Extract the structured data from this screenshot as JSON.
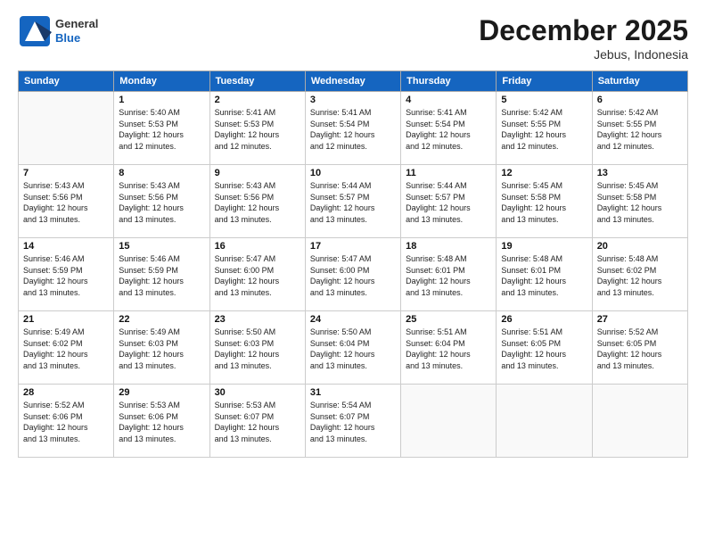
{
  "header": {
    "logo_general": "General",
    "logo_blue": "Blue",
    "title": "December 2025",
    "subtitle": "Jebus, Indonesia"
  },
  "weekdays": [
    "Sunday",
    "Monday",
    "Tuesday",
    "Wednesday",
    "Thursday",
    "Friday",
    "Saturday"
  ],
  "weeks": [
    [
      {
        "day": "",
        "info": ""
      },
      {
        "day": "1",
        "info": "Sunrise: 5:40 AM\nSunset: 5:53 PM\nDaylight: 12 hours\nand 12 minutes."
      },
      {
        "day": "2",
        "info": "Sunrise: 5:41 AM\nSunset: 5:53 PM\nDaylight: 12 hours\nand 12 minutes."
      },
      {
        "day": "3",
        "info": "Sunrise: 5:41 AM\nSunset: 5:54 PM\nDaylight: 12 hours\nand 12 minutes."
      },
      {
        "day": "4",
        "info": "Sunrise: 5:41 AM\nSunset: 5:54 PM\nDaylight: 12 hours\nand 12 minutes."
      },
      {
        "day": "5",
        "info": "Sunrise: 5:42 AM\nSunset: 5:55 PM\nDaylight: 12 hours\nand 12 minutes."
      },
      {
        "day": "6",
        "info": "Sunrise: 5:42 AM\nSunset: 5:55 PM\nDaylight: 12 hours\nand 12 minutes."
      }
    ],
    [
      {
        "day": "7",
        "info": "Sunrise: 5:43 AM\nSunset: 5:56 PM\nDaylight: 12 hours\nand 13 minutes."
      },
      {
        "day": "8",
        "info": "Sunrise: 5:43 AM\nSunset: 5:56 PM\nDaylight: 12 hours\nand 13 minutes."
      },
      {
        "day": "9",
        "info": "Sunrise: 5:43 AM\nSunset: 5:56 PM\nDaylight: 12 hours\nand 13 minutes."
      },
      {
        "day": "10",
        "info": "Sunrise: 5:44 AM\nSunset: 5:57 PM\nDaylight: 12 hours\nand 13 minutes."
      },
      {
        "day": "11",
        "info": "Sunrise: 5:44 AM\nSunset: 5:57 PM\nDaylight: 12 hours\nand 13 minutes."
      },
      {
        "day": "12",
        "info": "Sunrise: 5:45 AM\nSunset: 5:58 PM\nDaylight: 12 hours\nand 13 minutes."
      },
      {
        "day": "13",
        "info": "Sunrise: 5:45 AM\nSunset: 5:58 PM\nDaylight: 12 hours\nand 13 minutes."
      }
    ],
    [
      {
        "day": "14",
        "info": "Sunrise: 5:46 AM\nSunset: 5:59 PM\nDaylight: 12 hours\nand 13 minutes."
      },
      {
        "day": "15",
        "info": "Sunrise: 5:46 AM\nSunset: 5:59 PM\nDaylight: 12 hours\nand 13 minutes."
      },
      {
        "day": "16",
        "info": "Sunrise: 5:47 AM\nSunset: 6:00 PM\nDaylight: 12 hours\nand 13 minutes."
      },
      {
        "day": "17",
        "info": "Sunrise: 5:47 AM\nSunset: 6:00 PM\nDaylight: 12 hours\nand 13 minutes."
      },
      {
        "day": "18",
        "info": "Sunrise: 5:48 AM\nSunset: 6:01 PM\nDaylight: 12 hours\nand 13 minutes."
      },
      {
        "day": "19",
        "info": "Sunrise: 5:48 AM\nSunset: 6:01 PM\nDaylight: 12 hours\nand 13 minutes."
      },
      {
        "day": "20",
        "info": "Sunrise: 5:48 AM\nSunset: 6:02 PM\nDaylight: 12 hours\nand 13 minutes."
      }
    ],
    [
      {
        "day": "21",
        "info": "Sunrise: 5:49 AM\nSunset: 6:02 PM\nDaylight: 12 hours\nand 13 minutes."
      },
      {
        "day": "22",
        "info": "Sunrise: 5:49 AM\nSunset: 6:03 PM\nDaylight: 12 hours\nand 13 minutes."
      },
      {
        "day": "23",
        "info": "Sunrise: 5:50 AM\nSunset: 6:03 PM\nDaylight: 12 hours\nand 13 minutes."
      },
      {
        "day": "24",
        "info": "Sunrise: 5:50 AM\nSunset: 6:04 PM\nDaylight: 12 hours\nand 13 minutes."
      },
      {
        "day": "25",
        "info": "Sunrise: 5:51 AM\nSunset: 6:04 PM\nDaylight: 12 hours\nand 13 minutes."
      },
      {
        "day": "26",
        "info": "Sunrise: 5:51 AM\nSunset: 6:05 PM\nDaylight: 12 hours\nand 13 minutes."
      },
      {
        "day": "27",
        "info": "Sunrise: 5:52 AM\nSunset: 6:05 PM\nDaylight: 12 hours\nand 13 minutes."
      }
    ],
    [
      {
        "day": "28",
        "info": "Sunrise: 5:52 AM\nSunset: 6:06 PM\nDaylight: 12 hours\nand 13 minutes."
      },
      {
        "day": "29",
        "info": "Sunrise: 5:53 AM\nSunset: 6:06 PM\nDaylight: 12 hours\nand 13 minutes."
      },
      {
        "day": "30",
        "info": "Sunrise: 5:53 AM\nSunset: 6:07 PM\nDaylight: 12 hours\nand 13 minutes."
      },
      {
        "day": "31",
        "info": "Sunrise: 5:54 AM\nSunset: 6:07 PM\nDaylight: 12 hours\nand 13 minutes."
      },
      {
        "day": "",
        "info": ""
      },
      {
        "day": "",
        "info": ""
      },
      {
        "day": "",
        "info": ""
      }
    ]
  ]
}
